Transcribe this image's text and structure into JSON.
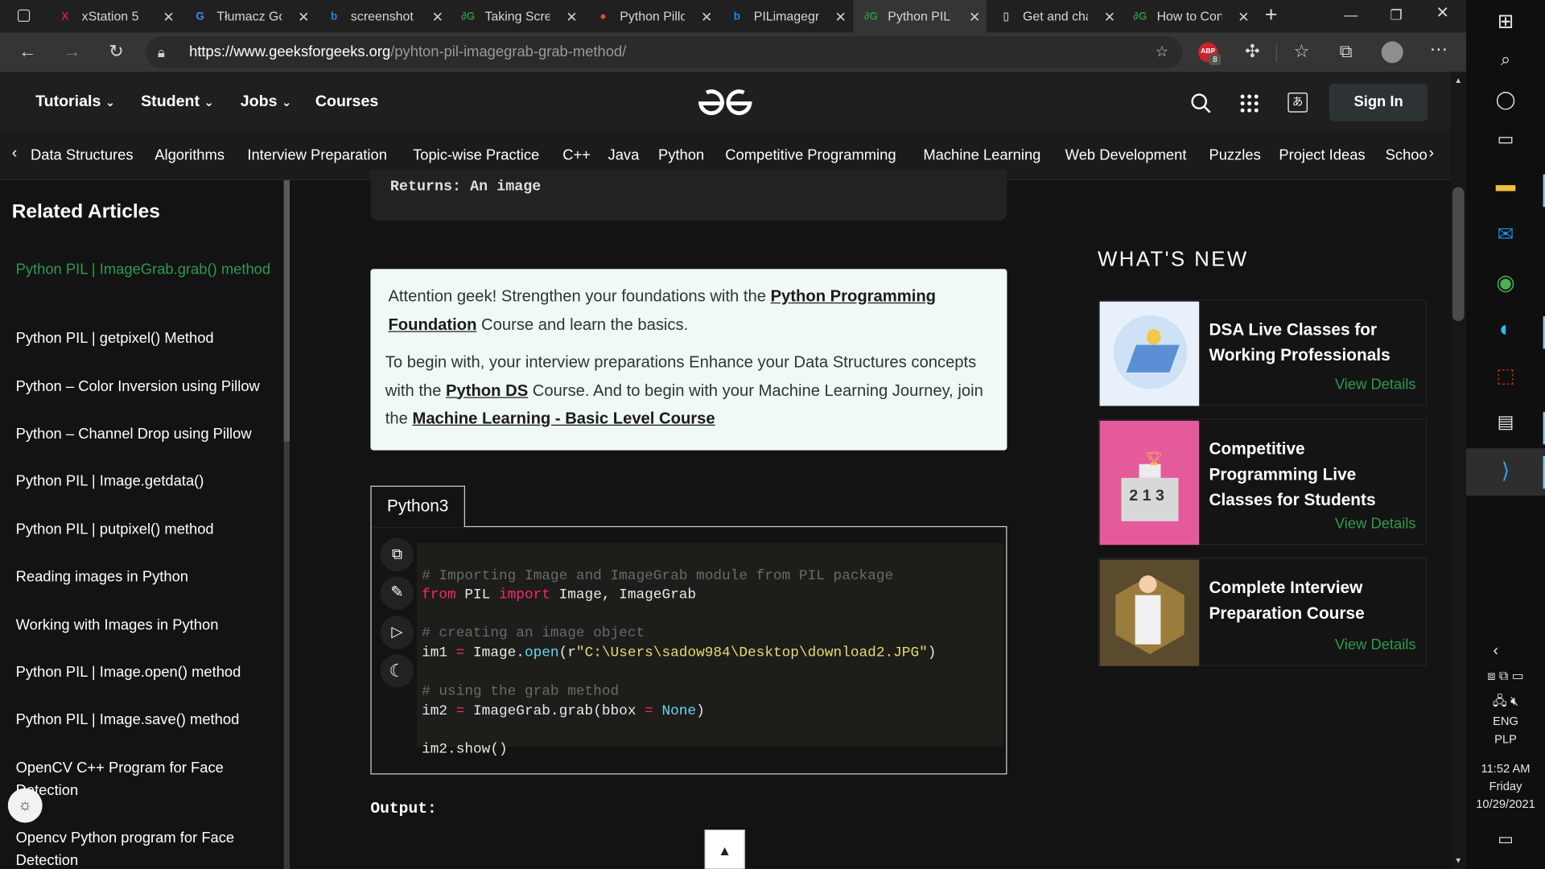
{
  "browser": {
    "tabs": [
      {
        "title": "xStation 5",
        "color": "#c9242b",
        "icon": "x-icon",
        "glyph": "X"
      },
      {
        "title": "Tłumacz Go",
        "color": "#4285f4",
        "icon": "translate-icon",
        "glyph": "G"
      },
      {
        "title": "screenshot i",
        "color": "#1e88e5",
        "icon": "bing-icon",
        "glyph": "b"
      },
      {
        "title": "Taking Scree",
        "color": "#2f8d46",
        "icon": "gfg-icon",
        "glyph": "∂G"
      },
      {
        "title": "Python Pillo",
        "color": "#e14c3c",
        "icon": "chrome-like-icon",
        "glyph": "●"
      },
      {
        "title": "PILimagegra",
        "color": "#1e88e5",
        "icon": "bing-icon",
        "glyph": "b"
      },
      {
        "title": "Python PIL |",
        "color": "#2f8d46",
        "icon": "gfg-icon",
        "glyph": "∂G",
        "active": true
      },
      {
        "title": "Get and cha",
        "color": "#ffffff",
        "icon": "document-icon",
        "glyph": "▯"
      },
      {
        "title": "How to Con",
        "color": "#2f8d46",
        "icon": "gfg-icon",
        "glyph": "∂G"
      }
    ],
    "url_domain": "https://www.geeksforgeeks.org",
    "url_path": "/pyhton-pil-imagegrab-grab-method/",
    "extension_badge": "8"
  },
  "site": {
    "nav": [
      "Tutorials",
      "Student",
      "Jobs",
      "Courses"
    ],
    "signin": "Sign In",
    "subnav": [
      "Data Structures",
      "Algorithms",
      "Interview Preparation",
      "Topic-wise Practice",
      "C++",
      "Java",
      "Python",
      "Competitive Programming",
      "Machine Learning",
      "Web Development",
      "Puzzles",
      "Project Ideas",
      "Schoo"
    ]
  },
  "sidebar": {
    "title": "Related Articles",
    "items": [
      "Python PIL | ImageGrab.grab() method",
      "Python PIL | getpixel() Method",
      "Python – Color Inversion using Pillow",
      "Python – Channel Drop using Pillow",
      "Python PIL | Image.getdata()",
      "Python PIL | putpixel() method",
      "Reading images in Python",
      "Working with Images in Python",
      "Python PIL | Image.open() method",
      "Python PIL | Image.save() method",
      "OpenCV C++ Program for Face Detection",
      "Opencv Python program for Face Detection"
    ]
  },
  "article": {
    "returns": "Returns: An image",
    "attention": {
      "p1_a": "Attention geek! Strengthen your foundations with the ",
      "p1_link": "Python Programming Foundation",
      "p1_b": " Course and learn the basics.",
      "p2_a": "To begin with, your interview preparations Enhance your Data Structures concepts with the ",
      "p2_link1": "Python DS",
      "p2_b": " Course. And to begin with your Machine Learning Journey, join the ",
      "p2_link2": "Machine Learning - Basic Level Course"
    },
    "code_tab": "Python3",
    "code": {
      "c1": "# Importing Image and ImageGrab module from PIL package",
      "l2_kw1": "from",
      "l2_mod": " PIL ",
      "l2_kw2": "import",
      "l2_rest": " Image, ImageGrab",
      "c2": "# creating an image object",
      "l3_a": "im1 ",
      "l3_eq": "=",
      "l3_b": " Image.",
      "l3_fn": "open",
      "l3_c": "(r",
      "l3_str": "\"C:\\Users\\sadow984\\Desktop\\download2.JPG\"",
      "l3_d": ")",
      "c3": "# using the grab method",
      "l4_a": "im2 ",
      "l4_eq": "=",
      "l4_b": " ImageGrab.grab(bbox ",
      "l4_eq2": "=",
      "l4_none": " None",
      "l4_c": ")",
      "l5": "im2.show()"
    },
    "output_label": "Output:"
  },
  "whats_new": {
    "title": "WHAT'S NEW",
    "cards": [
      {
        "title": "DSA Live Classes for Working Professionals",
        "link": "View Details"
      },
      {
        "title": "Competitive Programming Live Classes for Students",
        "link": "View Details"
      },
      {
        "title": "Complete Interview Preparation Course",
        "link": "View Details"
      }
    ]
  },
  "taskbar": {
    "lang1": "ENG",
    "lang2": "PLP",
    "time": "11:52 AM",
    "day": "Friday",
    "date": "10/29/2021"
  }
}
